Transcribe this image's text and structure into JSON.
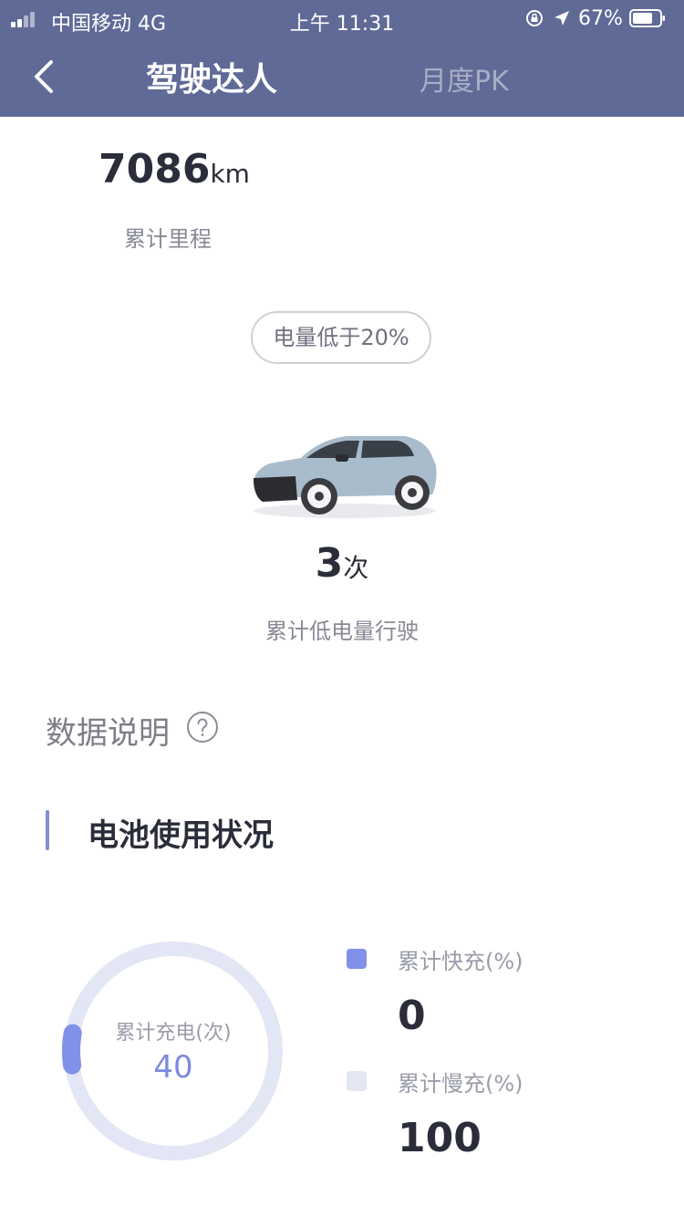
{
  "status_bar": {
    "carrier": "中国移动  4G",
    "time": "上午 11:31",
    "battery": "67%"
  },
  "nav": {
    "title": "驾驶达人",
    "tab": "月度PK"
  },
  "mileage": {
    "value": "7086",
    "unit": "km",
    "label": "累计里程"
  },
  "low_battery": {
    "pill": "电量低于20%",
    "count": "3",
    "count_unit": "次",
    "label": "累计低电量行驶"
  },
  "data_note": {
    "label": "数据说明",
    "icon": "question-circle-icon"
  },
  "battery_section": {
    "title": "电池使用状况",
    "donut": {
      "label": "累计充电(次)",
      "value": "40",
      "fast_fraction": 0.05
    },
    "legend": [
      {
        "label": "累计快充(%)",
        "value": "0",
        "color": "#8190e8"
      },
      {
        "label": "累计慢充(%)",
        "value": "100",
        "color": "#e3e6f4"
      }
    ]
  },
  "colors": {
    "header_bg": "#5f6a97",
    "accent": "#8190e8",
    "ring_bg": "#e3e6f4"
  }
}
